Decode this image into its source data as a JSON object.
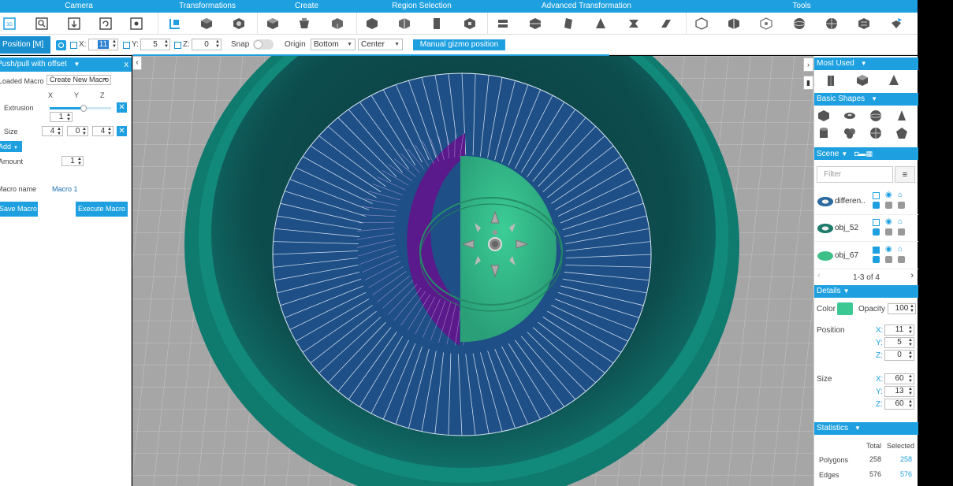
{
  "toolbar": {
    "groups": [
      "Camera",
      "Transformations",
      "Create",
      "Region Selection",
      "Advanced Transformation",
      "Tools"
    ]
  },
  "posbar": {
    "mode_label": "Position [M]",
    "x_label": "X:",
    "x_value": "11",
    "y_label": "Y:",
    "y_value": "5",
    "z_label": "Z:",
    "z_value": "0",
    "snap_label": "Snap",
    "origin_label": "Origin",
    "origin_value": "Bottom",
    "center_value": "Center",
    "gizmo_button": "Manual gizmo position"
  },
  "left_panel": {
    "title": "Push/pull with offset",
    "loaded_macro_label": "Loaded Macro",
    "loaded_macro_value": "Create New Macro",
    "col_x": "X",
    "col_y": "Y",
    "col_z": "Z",
    "extrusion_label": "Extrusion",
    "extrusion_value": "1",
    "extrusion_slider": 0.55,
    "size_label": "Size",
    "size_x": "4",
    "size_y": "0",
    "size_z": "4",
    "add_button": "Add",
    "amount_label": "Amount",
    "amount_value": "1",
    "macro_name_label": "Macro name",
    "macro_name_value": "Macro 1",
    "save_button": "Save Macro",
    "execute_button": "Execute Macro"
  },
  "right_panel": {
    "most_used": "Most Used",
    "basic_shapes": "Basic Shapes",
    "scene": "Scene",
    "filter_placeholder": "Filter",
    "scene_items": [
      {
        "name": "differen..",
        "color": "#2a6aa0"
      },
      {
        "name": "obj_52",
        "color": "#1e7a6a"
      },
      {
        "name": "obj_67",
        "color": "#3dbf8a"
      }
    ],
    "pager": "1-3 of 4",
    "details": "Details",
    "color_label": "Color",
    "color_value": "#3cc892",
    "opacity_label": "Opacity",
    "opacity_value": "100",
    "position_label": "Position",
    "pos_x": "11",
    "pos_y": "5",
    "pos_z": "0",
    "size_label": "Size",
    "size_x": "60",
    "size_y": "13",
    "size_z": "60",
    "axis_x": "X:",
    "axis_y": "Y:",
    "axis_z": "Z:",
    "statistics": "Statistics",
    "stat_total": "Total",
    "stat_selected": "Selected",
    "polygons_label": "Polygons",
    "polygons_total": "258",
    "polygons_selected": "258",
    "edges_label": "Edges",
    "edges_total": "576",
    "edges_selected": "576"
  },
  "colors": {
    "accent": "#1ea0e0",
    "bowl": "#127a70",
    "disc": "#1e4f86",
    "green": "#34b486",
    "purple": "#5b1a8c"
  }
}
